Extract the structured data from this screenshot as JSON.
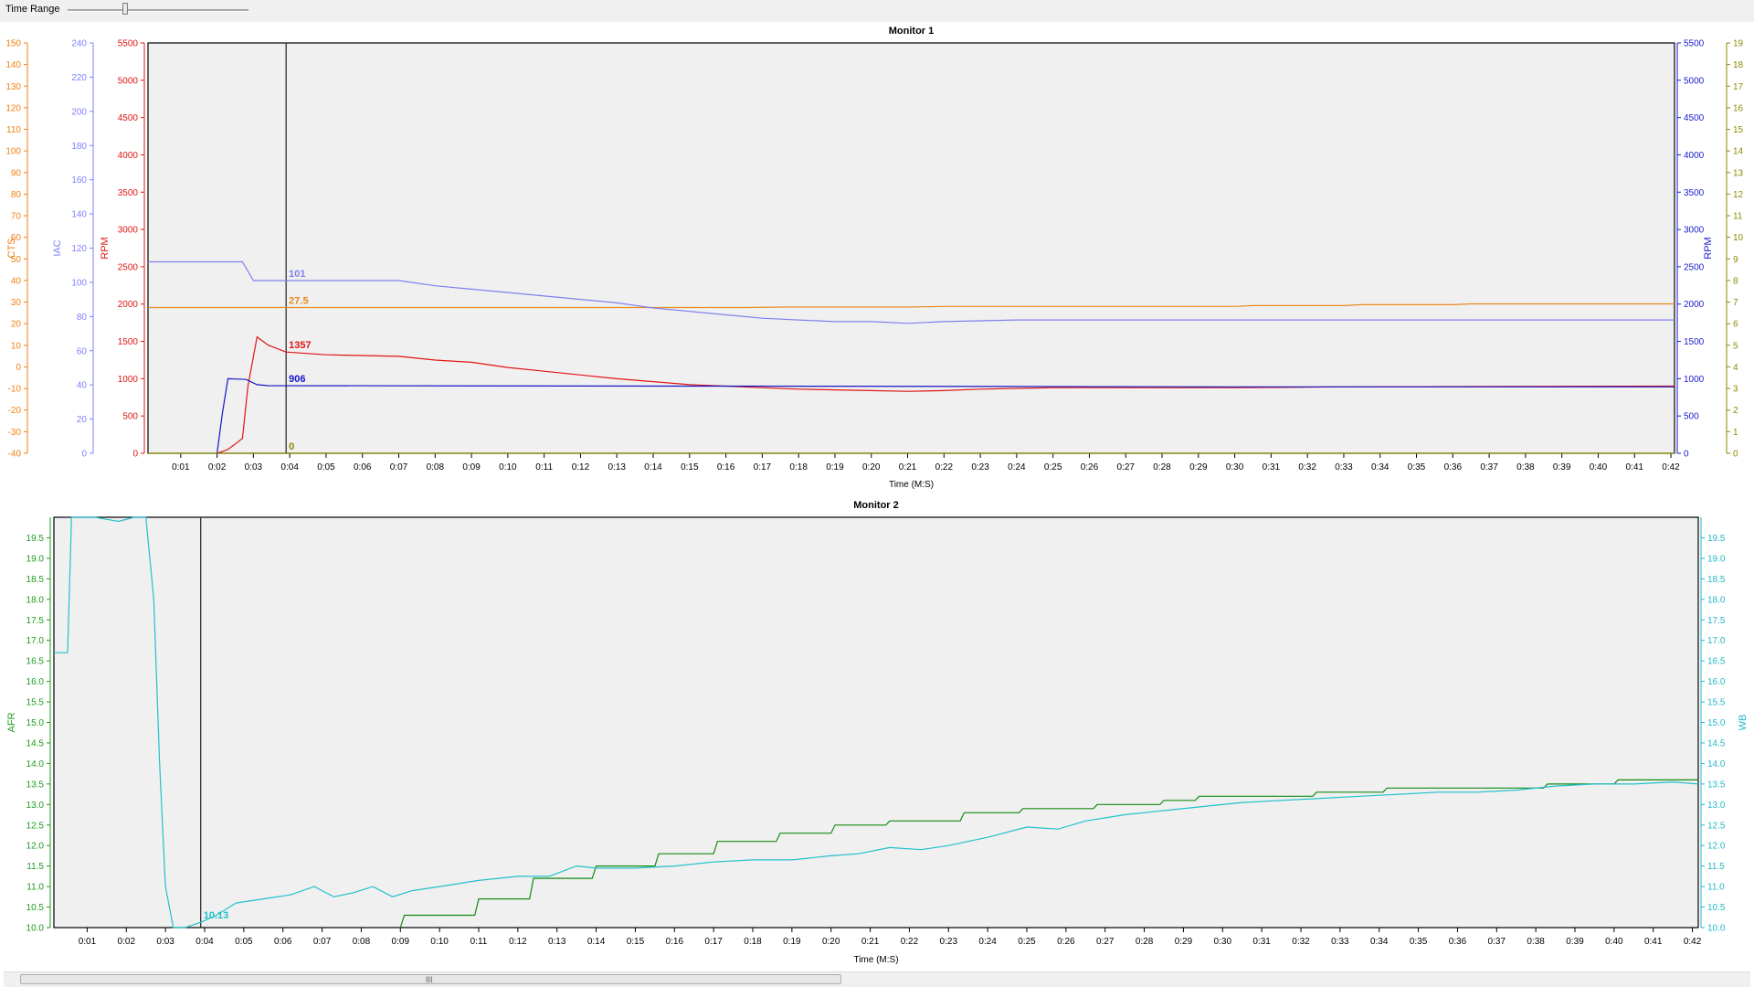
{
  "toolbar": {
    "time_range_label": "Time Range",
    "slider_value": 0.32
  },
  "scrollbar": {
    "grip": "III",
    "thumb_fraction": 0.47
  },
  "chart_data": [
    {
      "type": "line",
      "title": "Monitor 1",
      "xlabel": "Time (M:S)",
      "x_ticks": [
        "0:01",
        "0:02",
        "0:03",
        "0:04",
        "0:05",
        "0:06",
        "0:07",
        "0:08",
        "0:09",
        "0:10",
        "0:11",
        "0:12",
        "0:13",
        "0:14",
        "0:15",
        "0:16",
        "0:17",
        "0:18",
        "0:19",
        "0:20",
        "0:21",
        "0:22",
        "0:23",
        "0:24",
        "0:25",
        "0:26",
        "0:27",
        "0:28",
        "0:29",
        "0:30",
        "0:31",
        "0:32",
        "0:33",
        "0:34",
        "0:35",
        "0:36",
        "0:37",
        "0:38",
        "0:39",
        "0:40",
        "0:41",
        "0:42"
      ],
      "xlim": [
        0.1,
        42.1
      ],
      "cursor_x": 3.9,
      "axes": [
        {
          "id": "cts",
          "label": "CTS",
          "side": "left",
          "color": "#f07f14",
          "min": -40,
          "max": 150,
          "step": 10
        },
        {
          "id": "iac",
          "label": "IAC",
          "side": "left",
          "color": "#8080ff",
          "min": 0,
          "max": 240,
          "step": 20
        },
        {
          "id": "rpm_l",
          "label": "RPM",
          "side": "left",
          "color": "#e01515",
          "min": 0,
          "max": 5500,
          "step": 500
        },
        {
          "id": "rpm_r",
          "label": "RPM",
          "side": "right",
          "color": "#1a1ad0",
          "min": 0,
          "max": 5500,
          "step": 500
        },
        {
          "id": "v",
          "label": "",
          "side": "right",
          "color": "#8a8a00",
          "min": 0,
          "max": 19,
          "step": 1
        }
      ],
      "series": [
        {
          "axis": "cts",
          "color": "#e88a20",
          "cursor_value": "27.5",
          "points": [
            [
              0.1,
              27.5
            ],
            [
              16.5,
              27.5
            ],
            [
              17.5,
              27.7
            ],
            [
              21,
              27.7
            ],
            [
              22,
              28.0
            ],
            [
              30,
              28.0
            ],
            [
              30.5,
              28.4
            ],
            [
              33,
              28.4
            ],
            [
              33.5,
              28.8
            ],
            [
              36,
              28.8
            ],
            [
              36.5,
              29.2
            ],
            [
              42.1,
              29.2
            ]
          ]
        },
        {
          "axis": "iac",
          "color": "#8080f0",
          "cursor_value": "101",
          "points": [
            [
              0.1,
              112
            ],
            [
              2.7,
              112
            ],
            [
              3.0,
              101
            ],
            [
              7,
              101
            ],
            [
              8,
              98
            ],
            [
              9,
              96
            ],
            [
              11,
              92
            ],
            [
              12,
              90
            ],
            [
              13,
              88
            ],
            [
              14,
              85
            ],
            [
              15,
              83
            ],
            [
              16,
              81
            ],
            [
              17,
              79
            ],
            [
              18,
              78
            ],
            [
              19,
              77
            ],
            [
              20,
              77
            ],
            [
              21,
              76
            ],
            [
              22,
              77
            ],
            [
              24,
              78
            ],
            [
              42.1,
              78
            ]
          ]
        },
        {
          "axis": "rpm_l",
          "color": "#e01515",
          "cursor_value": "1357",
          "points": [
            [
              2.0,
              0
            ],
            [
              2.3,
              50
            ],
            [
              2.7,
              200
            ],
            [
              2.85,
              900
            ],
            [
              3.1,
              1560
            ],
            [
              3.4,
              1450
            ],
            [
              3.9,
              1357
            ],
            [
              5,
              1320
            ],
            [
              7,
              1300
            ],
            [
              8,
              1250
            ],
            [
              9,
              1220
            ],
            [
              10,
              1150
            ],
            [
              11,
              1100
            ],
            [
              12,
              1050
            ],
            [
              13,
              1000
            ],
            [
              14,
              960
            ],
            [
              15,
              920
            ],
            [
              16,
              900
            ],
            [
              17,
              880
            ],
            [
              18,
              860
            ],
            [
              20,
              840
            ],
            [
              21,
              830
            ],
            [
              22,
              840
            ],
            [
              23,
              860
            ],
            [
              25,
              880
            ],
            [
              30,
              880
            ],
            [
              33,
              890
            ],
            [
              42.1,
              900
            ]
          ]
        },
        {
          "axis": "rpm_r",
          "color": "#1515c8",
          "cursor_value": "906",
          "points": [
            [
              2.0,
              0
            ],
            [
              2.15,
              550
            ],
            [
              2.3,
              1000
            ],
            [
              2.8,
              990
            ],
            [
              3.1,
              920
            ],
            [
              3.4,
              906
            ],
            [
              16,
              900
            ],
            [
              24,
              895
            ],
            [
              30,
              890
            ],
            [
              42.1,
              890
            ]
          ]
        },
        {
          "axis": "v",
          "color": "#8a8a00",
          "cursor_value": "0",
          "points": [
            [
              0.1,
              0
            ],
            [
              42.1,
              0
            ]
          ]
        }
      ]
    },
    {
      "type": "line",
      "title": "Monitor 2",
      "xlabel": "Time (M:S)",
      "x_ticks": [
        "0:01",
        "0:02",
        "0:03",
        "0:04",
        "0:05",
        "0:06",
        "0:07",
        "0:08",
        "0:09",
        "0:10",
        "0:11",
        "0:12",
        "0:13",
        "0:14",
        "0:15",
        "0:16",
        "0:17",
        "0:18",
        "0:19",
        "0:20",
        "0:21",
        "0:22",
        "0:23",
        "0:24",
        "0:25",
        "0:26",
        "0:27",
        "0:28",
        "0:29",
        "0:30",
        "0:31",
        "0:32",
        "0:33",
        "0:34",
        "0:35",
        "0:36",
        "0:37",
        "0:38",
        "0:39",
        "0:40",
        "0:41",
        "0:42"
      ],
      "xlim": [
        0.15,
        42.15
      ],
      "cursor_x": 3.9,
      "axes": [
        {
          "id": "afr",
          "label": "AFR",
          "side": "left",
          "color": "#1e9b1e",
          "min": 10,
          "max": 20,
          "step": 0.5,
          "top_tick": 19.5
        },
        {
          "id": "wb",
          "label": "WB",
          "side": "right",
          "color": "#20b8c8",
          "min": 10,
          "max": 20,
          "step": 0.5,
          "top_tick": 19.5
        }
      ],
      "series": [
        {
          "axis": "afr",
          "color": "#138a13",
          "cursor_value": "",
          "points": [
            [
              9.0,
              10.0
            ],
            [
              9.1,
              10.3
            ],
            [
              10.9,
              10.3
            ],
            [
              11.0,
              10.7
            ],
            [
              12.3,
              10.7
            ],
            [
              12.4,
              11.2
            ],
            [
              13.9,
              11.2
            ],
            [
              14.0,
              11.5
            ],
            [
              15.5,
              11.5
            ],
            [
              15.6,
              11.8
            ],
            [
              17.0,
              11.8
            ],
            [
              17.1,
              12.1
            ],
            [
              18.6,
              12.1
            ],
            [
              18.7,
              12.3
            ],
            [
              20.0,
              12.3
            ],
            [
              20.1,
              12.5
            ],
            [
              21.4,
              12.5
            ],
            [
              21.5,
              12.6
            ],
            [
              23.3,
              12.6
            ],
            [
              23.4,
              12.8
            ],
            [
              24.8,
              12.8
            ],
            [
              24.9,
              12.9
            ],
            [
              26.7,
              12.9
            ],
            [
              26.8,
              13.0
            ],
            [
              28.4,
              13.0
            ],
            [
              28.5,
              13.1
            ],
            [
              29.3,
              13.1
            ],
            [
              29.4,
              13.2
            ],
            [
              32.3,
              13.2
            ],
            [
              32.4,
              13.3
            ],
            [
              34.1,
              13.3
            ],
            [
              34.2,
              13.4
            ],
            [
              38.2,
              13.4
            ],
            [
              38.3,
              13.5
            ],
            [
              40.0,
              13.5
            ],
            [
              40.1,
              13.6
            ],
            [
              42.15,
              13.6
            ]
          ]
        },
        {
          "axis": "wb",
          "color": "#22c0cc",
          "cursor_value": "10.13",
          "points": [
            [
              0.15,
              16.7
            ],
            [
              0.5,
              16.7
            ],
            [
              0.6,
              20.0
            ],
            [
              1.2,
              20.0
            ],
            [
              1.8,
              19.9
            ],
            [
              2.2,
              20.0
            ],
            [
              2.5,
              20.0
            ],
            [
              2.7,
              18.0
            ],
            [
              2.85,
              14.0
            ],
            [
              3.0,
              11.0
            ],
            [
              3.2,
              10.0
            ],
            [
              3.5,
              10.0
            ],
            [
              3.9,
              10.13
            ],
            [
              4.3,
              10.3
            ],
            [
              4.8,
              10.6
            ],
            [
              5.5,
              10.7
            ],
            [
              6.2,
              10.8
            ],
            [
              6.8,
              11.0
            ],
            [
              7.3,
              10.75
            ],
            [
              7.8,
              10.85
            ],
            [
              8.3,
              11.0
            ],
            [
              8.8,
              10.75
            ],
            [
              9.3,
              10.9
            ],
            [
              10,
              11.0
            ],
            [
              11,
              11.15
            ],
            [
              12,
              11.25
            ],
            [
              12.8,
              11.25
            ],
            [
              13.5,
              11.5
            ],
            [
              14,
              11.45
            ],
            [
              15,
              11.45
            ],
            [
              16,
              11.5
            ],
            [
              17,
              11.6
            ],
            [
              18,
              11.65
            ],
            [
              19,
              11.65
            ],
            [
              20,
              11.75
            ],
            [
              20.7,
              11.8
            ],
            [
              21.5,
              11.95
            ],
            [
              22.3,
              11.9
            ],
            [
              23,
              12.0
            ],
            [
              24,
              12.2
            ],
            [
              25,
              12.45
            ],
            [
              25.8,
              12.4
            ],
            [
              26.5,
              12.6
            ],
            [
              27.5,
              12.75
            ],
            [
              28.5,
              12.85
            ],
            [
              29.5,
              12.95
            ],
            [
              30.5,
              13.05
            ],
            [
              31.5,
              13.1
            ],
            [
              32.5,
              13.15
            ],
            [
              33.5,
              13.2
            ],
            [
              34.5,
              13.25
            ],
            [
              35.5,
              13.3
            ],
            [
              36.5,
              13.3
            ],
            [
              37.5,
              13.35
            ],
            [
              38.5,
              13.45
            ],
            [
              39.5,
              13.5
            ],
            [
              40.5,
              13.5
            ],
            [
              41.5,
              13.55
            ],
            [
              42.15,
              13.5
            ]
          ]
        }
      ]
    }
  ]
}
